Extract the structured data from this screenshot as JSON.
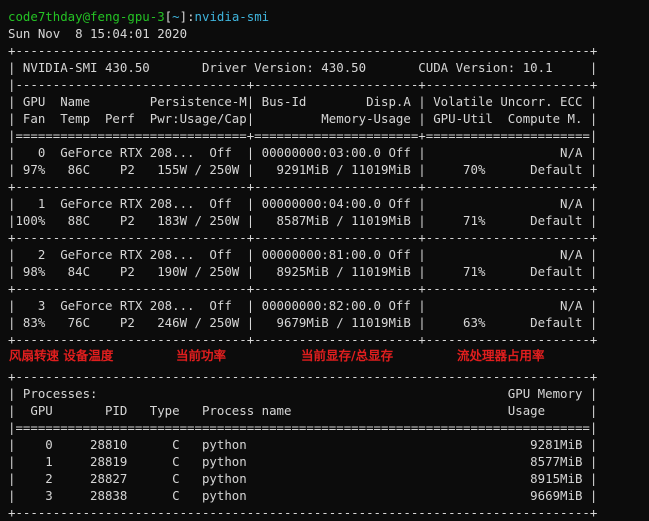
{
  "prompt": {
    "user_host": "code7thday@feng-gpu-3",
    "dir_open": "[",
    "dir": "~",
    "dir_close": "]",
    "symbol": ":",
    "command": "nvidia-smi"
  },
  "timestamp": "Sun Nov  8 15:04:01 2020",
  "smi": {
    "border_top": "+-----------------------------------------------------------------------------+",
    "version_line": "| NVIDIA-SMI 430.50       Driver Version: 430.50       CUDA Version: 10.1     |",
    "border_mid": "|-------------------------------+----------------------+----------------------+",
    "header1": "| GPU  Name        Persistence-M| Bus-Id        Disp.A | Volatile Uncorr. ECC |",
    "header2": "| Fan  Temp  Perf  Pwr:Usage/Cap|         Memory-Usage | GPU-Util  Compute M. |",
    "border_eq": "|===============================+======================+======================|",
    "gpus": [
      {
        "line1": "|   0  GeForce RTX 208...  Off  | 00000000:03:00.0 Off |                  N/A |",
        "line2": "| 97%   86C    P2   155W / 250W |   9291MiB / 11019MiB |     70%      Default |"
      },
      {
        "line1": "|   1  GeForce RTX 208...  Off  | 00000000:04:00.0 Off |                  N/A |",
        "line2": "|100%   88C    P2   183W / 250W |   8587MiB / 11019MiB |     71%      Default |"
      },
      {
        "line1": "|   2  GeForce RTX 208...  Off  | 00000000:81:00.0 Off |                  N/A |",
        "line2": "| 98%   84C    P2   190W / 250W |   8925MiB / 11019MiB |     71%      Default |"
      },
      {
        "line1": "|   3  GeForce RTX 208...  Off  | 00000000:82:00.0 Off |                  N/A |",
        "line2": "| 83%   76C    P2   246W / 250W |   9679MiB / 11019MiB |     63%      Default |"
      }
    ],
    "gpu_separator": "+-------------------------------+----------------------+----------------------+"
  },
  "annotations": {
    "fan_temp": "风扇转速 设备温度",
    "power": "当前功率",
    "memory": "当前显存/总显存",
    "util": "流处理器占用率"
  },
  "processes": {
    "border_top": "+-----------------------------------------------------------------------------+",
    "header1": "| Processes:                                                       GPU Memory |",
    "header2": "|  GPU       PID   Type   Process name                             Usage      |",
    "border_eq": "|=============================================================================|",
    "rows": [
      "|    0     28810      C   python                                      9281MiB |",
      "|    1     28819      C   python                                      8577MiB |",
      "|    2     28827      C   python                                      8915MiB |",
      "|    3     28838      C   python                                      9669MiB |"
    ],
    "border_bottom": "+-----------------------------------------------------------------------------+"
  },
  "colors": {
    "background": "#0c0c0c",
    "text": "#d6d6d6",
    "prompt_green": "#24c224",
    "prompt_cyan": "#3fb4dc",
    "annotation_red": "#e01e1e"
  }
}
